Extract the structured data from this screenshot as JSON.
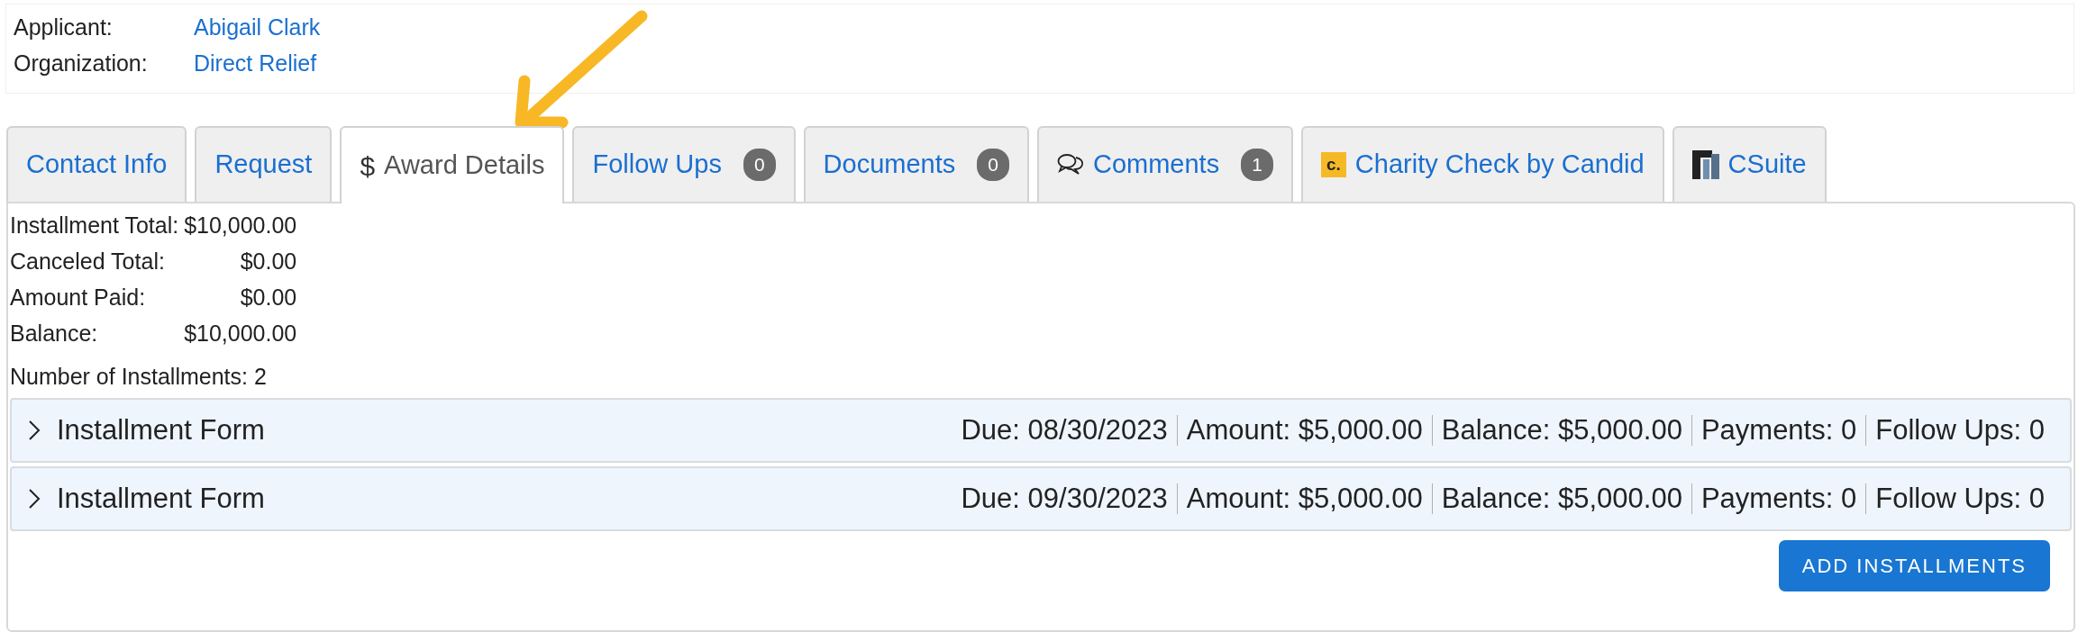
{
  "header": [
    {
      "label": "Applicant:",
      "value": "Abigail Clark"
    },
    {
      "label": "Organization:",
      "value": "Direct Relief"
    }
  ],
  "tabs": [
    {
      "label": "Contact Info",
      "selected": false
    },
    {
      "label": "Request",
      "selected": false
    },
    {
      "label": "Award Details",
      "selected": true,
      "kind": "dollar",
      "icon_text": "$"
    },
    {
      "label": "Follow Ups",
      "selected": false,
      "count": "0"
    },
    {
      "label": "Documents",
      "selected": false,
      "count": "0"
    },
    {
      "label": "Comments",
      "selected": false,
      "kind": "speech-bubbles",
      "count": "1"
    },
    {
      "label": "Charity Check by Candid",
      "selected": false,
      "kind": "candid",
      "icon_text": "c."
    },
    {
      "label": "CSuite",
      "selected": false,
      "kind": "csuite"
    }
  ],
  "summary": [
    {
      "label": "Installment Total:",
      "value": "$10,000.00"
    },
    {
      "label": "Canceled Total:",
      "value": "$0.00"
    },
    {
      "label": "Amount Paid:",
      "value": "$0.00"
    },
    {
      "label": "Balance:",
      "value": "$10,000.00"
    }
  ],
  "installment_count": "Number of Installments: 2",
  "installments": [
    {
      "title": "Installment Form",
      "expanded": false,
      "fields": [
        "Due: 08/30/2023",
        "Amount: $5,000.00",
        "Balance: $5,000.00",
        "Payments: 0",
        "Follow Ups: 0"
      ]
    },
    {
      "title": "Installment Form",
      "expanded": false,
      "fields": [
        "Due: 09/30/2023",
        "Amount: $5,000.00",
        "Balance: $5,000.00",
        "Payments: 0",
        "Follow Ups: 0"
      ]
    }
  ],
  "add_button": "ADD INSTALLMENTS"
}
